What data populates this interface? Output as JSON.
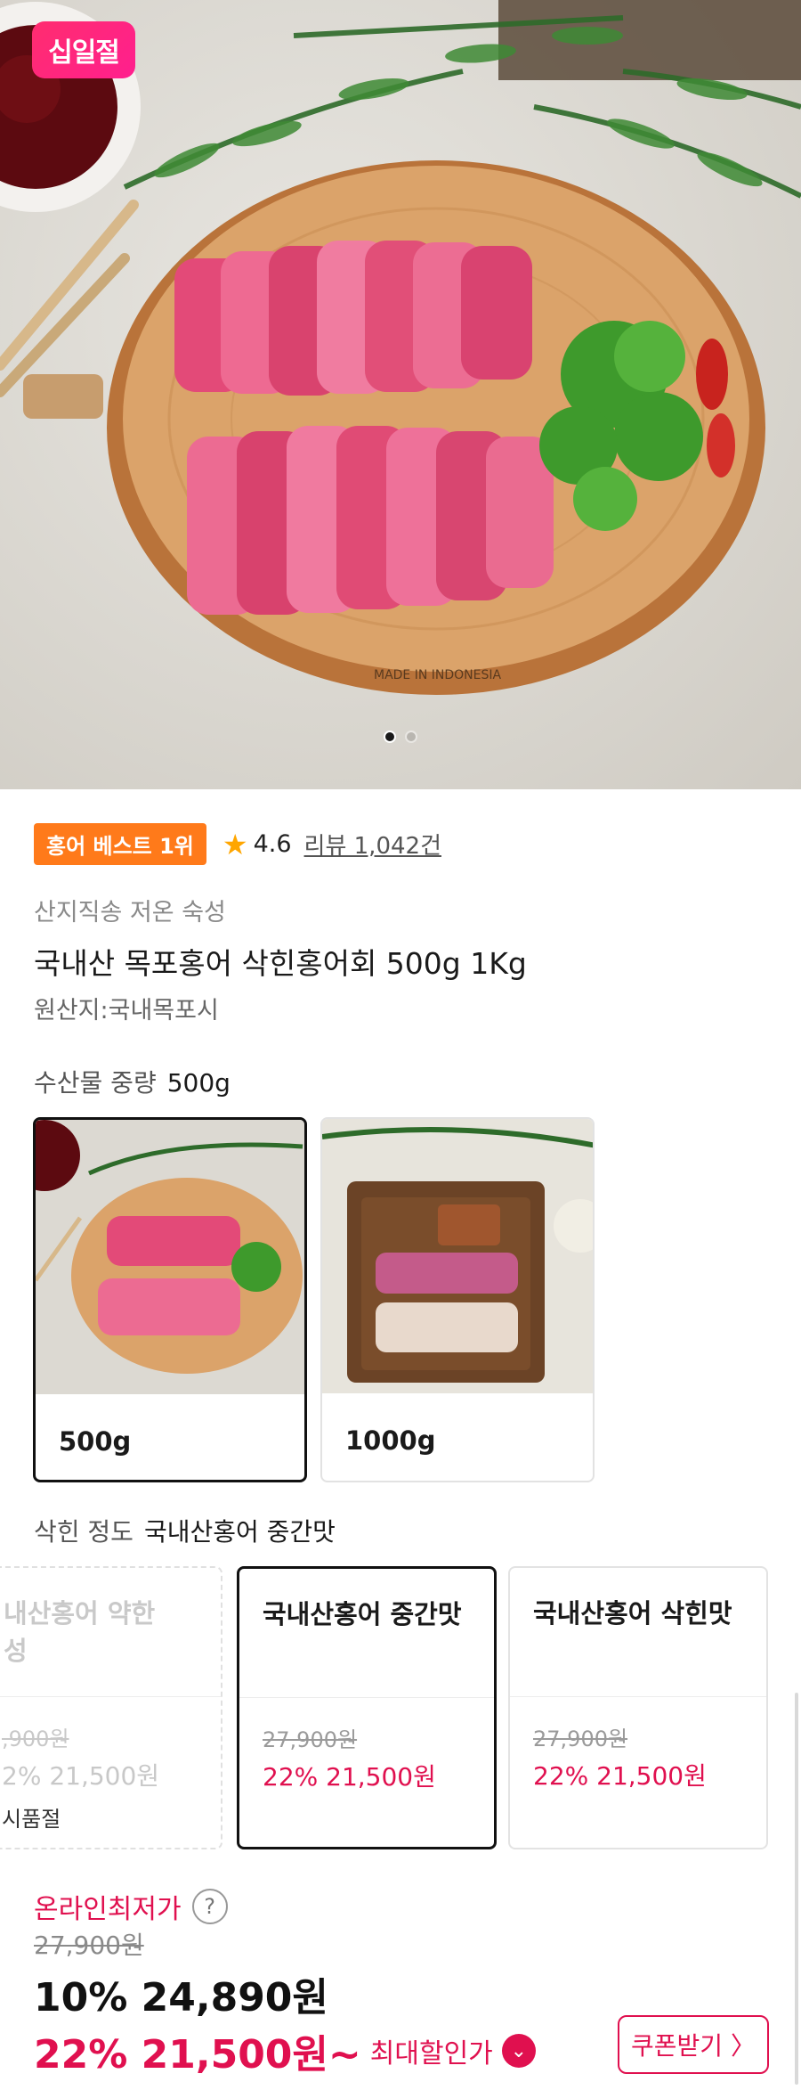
{
  "hero": {
    "brand_badge": "십일절",
    "board_text": "MADE IN INDONESIA",
    "slide_count": 2,
    "active_slide": 1
  },
  "product": {
    "rank_badge": "홍어 베스트 1위",
    "rating": "4.6",
    "review_text": "리뷰 1,042건",
    "seller": "산지직송 저온 숙성",
    "title": "국내산 목포홍어 삭힌홍어회 500g 1Kg",
    "origin": "원산지:국내목포시"
  },
  "weight_option": {
    "label": "수산물 중량",
    "selected": "500g",
    "items": [
      {
        "label": "500g"
      },
      {
        "label": "1000g"
      }
    ]
  },
  "taste_option": {
    "label": "삭힌 정도",
    "selected": "국내산홍어 중간맛",
    "items": [
      {
        "name_line1": "내산홍어 약한",
        "name_line2": "성",
        "old_price": ",900원",
        "new_price": "2% 21,500원",
        "status": "시품절"
      },
      {
        "name_line1": "국내산홍어 중간맛",
        "old_price": "27,900원",
        "new_price": "22% 21,500원"
      },
      {
        "name_line1": "국내산홍어 삭힌맛",
        "old_price": "27,900원",
        "new_price": "22% 21,500원"
      }
    ]
  },
  "price": {
    "lowest_label": "온라인최저가",
    "help": "?",
    "original": "27,900원",
    "sale": "10% 24,890원",
    "best": "22% 21,500원~",
    "best_label": "최대할인가",
    "coupon_button": "쿠폰받기 〉"
  },
  "colors": {
    "accent": "#e0104f",
    "brand": "#ff2d6f",
    "rank_badge": "#ff7a1a",
    "star": "#ffa600"
  }
}
